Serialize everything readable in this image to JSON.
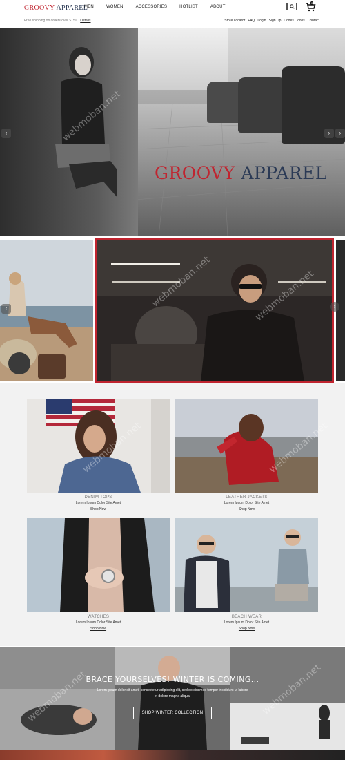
{
  "header": {
    "logo_word1": "GROOVY",
    "logo_word2": "APPAREL",
    "nav": [
      "MEN",
      "WOMEN",
      "ACCESSORIES",
      "HOTLIST",
      "ABOUT"
    ],
    "search_value": "",
    "shipping_text": "Free shipping on orders over $150.",
    "shipping_link": "Details",
    "util_links": [
      "Store Locator",
      "FAQ",
      "Login",
      "Sign Up",
      "Codes",
      "Icons",
      "Contact"
    ],
    "cart_count": "0"
  },
  "hero": {
    "title_word1": "GROOVY",
    "title_word2": "APPAREL"
  },
  "products": [
    {
      "title": "DENIM TOPS",
      "desc": "Lorem Ipsum Dolor Site Amet",
      "link": "Shop Now"
    },
    {
      "title": "LEATHER JACKETS",
      "desc": "Lorem Ipsum Dolor Site Amet",
      "link": "Shop Now"
    },
    {
      "title": "WATCHES",
      "desc": "Lorem Ipsum Dolor Site Amet",
      "link": "Shop Now"
    },
    {
      "title": "BEACH WEAR",
      "desc": "Lorem Ipsum Dolor Site Amet",
      "link": "Shop Now"
    }
  ],
  "winter": {
    "title": "BRACE YOURSELVES! WINTER IS COMING...",
    "body": "Lorem ipsum dolor sit amet, consectetur adipiscing elit, sed do eiusmod tempor incididunt ut labore et dolore magna aliqua.",
    "button": "SHOP WINTER COLLECTION"
  },
  "watermark": "webmoban.net",
  "colors": {
    "brand_red": "#c0242f",
    "brand_navy": "#2b3a55"
  }
}
